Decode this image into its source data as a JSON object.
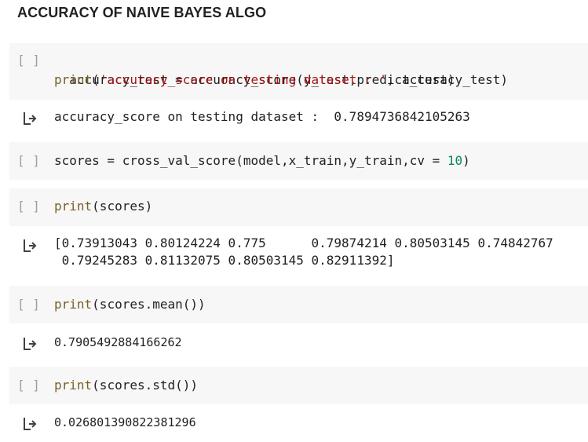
{
  "heading": "ACCURACY OF NAIVE BAYES ALGO",
  "run_brackets": "[ ]",
  "cells": {
    "c1": {
      "line1": "accuracy_test = accuracy_score(y_test,predict_test)",
      "line2_fn": "print",
      "line2_open": "(",
      "line2_str": "'accuracy_score on testing dataset : '",
      "line2_rest": ", accuracy_test)",
      "output": "accuracy_score on testing dataset :  0.7894736842105263"
    },
    "c2": {
      "line_pre": "scores = cross_val_score(model,x_train,y_train,cv = ",
      "line_num": "10",
      "line_post": ")"
    },
    "c3": {
      "fn": "print",
      "rest": "(scores)",
      "output_line1": "[0.73913043 0.80124224 0.775      0.79874214 0.80503145 0.74842767",
      "output_line2": " 0.79245283 0.81132075 0.80503145 0.82911392]"
    },
    "c4": {
      "fn": "print",
      "rest": "(scores.mean())",
      "output": "0.7905492884166262"
    },
    "c5": {
      "fn": "print",
      "rest": "(scores.std())",
      "output": "0.026801390822381296"
    }
  },
  "icons": {
    "run": "run-cell-icon",
    "output": "output-arrow-icon"
  },
  "colors": {
    "cell_bg": "#f7f7f7",
    "string": "#a31515",
    "function": "#795e26",
    "number": "#098658"
  }
}
